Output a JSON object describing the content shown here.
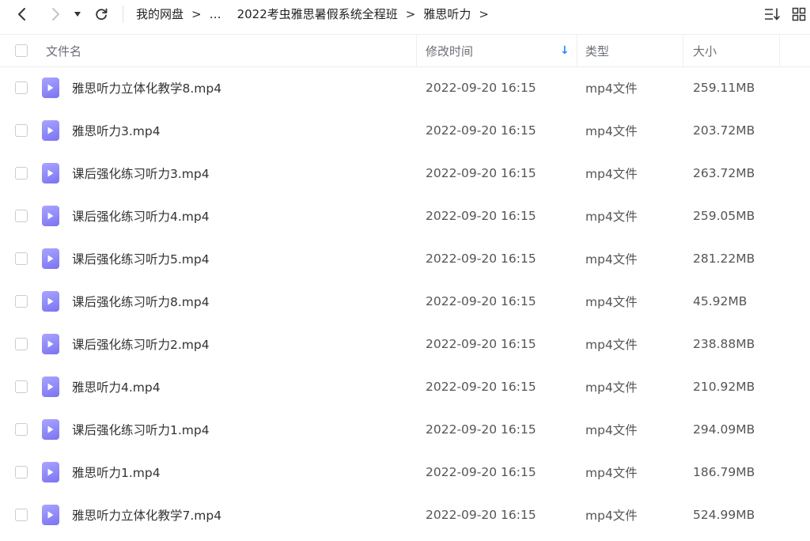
{
  "breadcrumb": {
    "items": [
      "我的网盘",
      "…",
      "2022考虫雅思暑假系统全程班",
      "雅思听力"
    ],
    "separator": ">"
  },
  "columns": {
    "name": "文件名",
    "modified": "修改时间",
    "type": "类型",
    "size": "大小",
    "sort_indicator": "↓"
  },
  "files": [
    {
      "name": "雅思听力立体化教学8.mp4",
      "modified": "2022-09-20 16:15",
      "type": "mp4文件",
      "size": "259.11MB"
    },
    {
      "name": "雅思听力3.mp4",
      "modified": "2022-09-20 16:15",
      "type": "mp4文件",
      "size": "203.72MB"
    },
    {
      "name": "课后强化练习听力3.mp4",
      "modified": "2022-09-20 16:15",
      "type": "mp4文件",
      "size": "263.72MB"
    },
    {
      "name": "课后强化练习听力4.mp4",
      "modified": "2022-09-20 16:15",
      "type": "mp4文件",
      "size": "259.05MB"
    },
    {
      "name": "课后强化练习听力5.mp4",
      "modified": "2022-09-20 16:15",
      "type": "mp4文件",
      "size": "281.22MB"
    },
    {
      "name": "课后强化练习听力8.mp4",
      "modified": "2022-09-20 16:15",
      "type": "mp4文件",
      "size": "45.92MB"
    },
    {
      "name": "课后强化练习听力2.mp4",
      "modified": "2022-09-20 16:15",
      "type": "mp4文件",
      "size": "238.88MB"
    },
    {
      "name": "雅思听力4.mp4",
      "modified": "2022-09-20 16:15",
      "type": "mp4文件",
      "size": "210.92MB"
    },
    {
      "name": "课后强化练习听力1.mp4",
      "modified": "2022-09-20 16:15",
      "type": "mp4文件",
      "size": "294.09MB"
    },
    {
      "name": "雅思听力1.mp4",
      "modified": "2022-09-20 16:15",
      "type": "mp4文件",
      "size": "186.79MB"
    },
    {
      "name": "雅思听力立体化教学7.mp4",
      "modified": "2022-09-20 16:15",
      "type": "mp4文件",
      "size": "524.99MB"
    }
  ],
  "icons": {
    "back": "back-arrow-icon",
    "forward": "forward-arrow-icon",
    "history": "dropdown-caret-icon",
    "refresh": "refresh-icon",
    "sort": "sort-list-icon",
    "grid": "grid-view-icon",
    "file": "video-file-icon"
  },
  "colors": {
    "accent": "#1e8cff",
    "file_icon": "#8b85f7",
    "disabled": "#c4c4c4"
  }
}
